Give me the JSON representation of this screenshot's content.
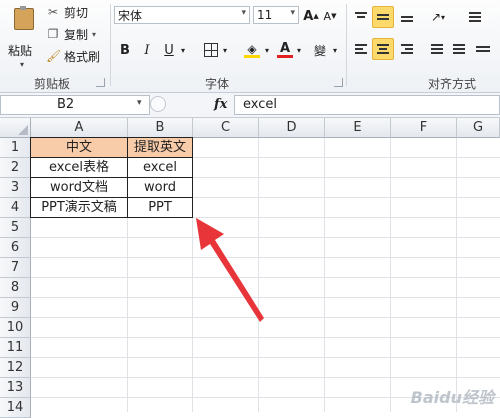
{
  "clipboard": {
    "paste_label": "粘贴",
    "cut_label": "剪切",
    "copy_label": "复制",
    "format_painter_label": "格式刷",
    "group_label": "剪贴板"
  },
  "font": {
    "name": "宋体",
    "size": "11",
    "grow_label": "A",
    "shrink_label": "A",
    "bold_label": "B",
    "italic_label": "I",
    "underline_label": "U",
    "wen_label": "變",
    "group_label": "字体",
    "font_color": "#e02020",
    "fill_color": "#ffd700"
  },
  "alignment": {
    "group_label": "对齐方式"
  },
  "formula_bar": {
    "cell_ref": "B2",
    "fx_label": "fx",
    "content": "excel"
  },
  "grid": {
    "columns": [
      "A",
      "B",
      "C",
      "D",
      "E",
      "F",
      "G"
    ],
    "rows": [
      "1",
      "2",
      "3",
      "4",
      "5",
      "6",
      "7",
      "8",
      "9",
      "10",
      "11",
      "12",
      "13",
      "14"
    ],
    "cells": {
      "A1": "中文",
      "B1": "提取英文",
      "A2": "excel表格",
      "B2": "excel",
      "A3": "word文档",
      "B3": "word",
      "A4": "PPT演示文稿",
      "B4": "PPT"
    },
    "header_fill": "#f8cba9"
  },
  "annotation": {
    "arrow_color": "#e8353a"
  },
  "watermark": "Baidu经验"
}
